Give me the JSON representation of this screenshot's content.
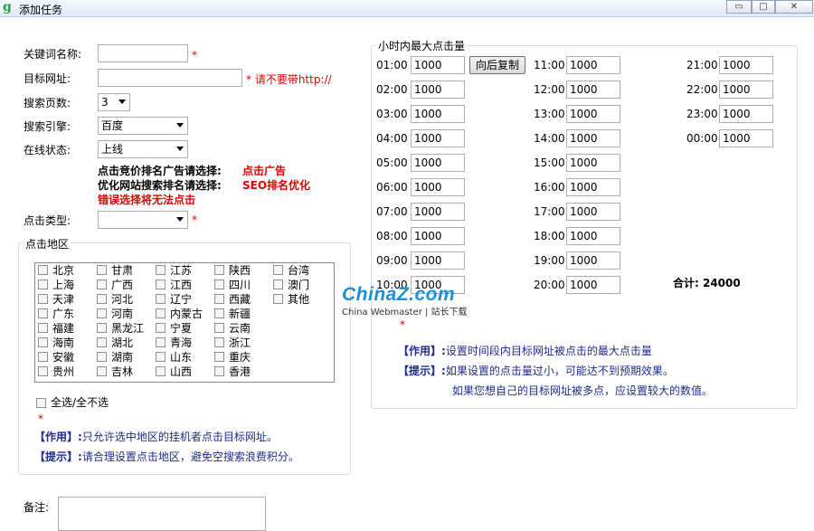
{
  "window": {
    "title": "添加任务",
    "min": "▭",
    "max": "□",
    "close": "✕"
  },
  "form": {
    "keyword_label": "关键词名称:",
    "url_label": "目标网址:",
    "url_hint": "* 请不要带http://",
    "pages_label": "搜索页数:",
    "pages_value": "3",
    "engine_label": "搜索引擎:",
    "engine_value": "百度",
    "status_label": "在线状态:",
    "status_value": "上线",
    "tip1_text": "点击竞价排名广告请选择:",
    "tip1_value": "点击广告",
    "tip2_text": "优化网站搜索排名请选择:",
    "tip2_value": "SEO排名优化",
    "tip3": "错误选择将无法点击",
    "click_type_label": "点击类型:",
    "star": "*",
    "note_label": "备注:"
  },
  "region": {
    "legend": "点击地区",
    "columns": [
      [
        "北京",
        "上海",
        "天津",
        "广东",
        "福建",
        "海南",
        "安徽",
        "贵州"
      ],
      [
        "甘肃",
        "广西",
        "河北",
        "河南",
        "黑龙江",
        "湖北",
        "湖南",
        "吉林"
      ],
      [
        "江苏",
        "江西",
        "辽宁",
        "内蒙古",
        "宁夏",
        "青海",
        "山东",
        "山西"
      ],
      [
        "陕西",
        "四川",
        "西藏",
        "新疆",
        "云南",
        "浙江",
        "重庆",
        "香港"
      ],
      [
        "台湾",
        "澳门",
        "其他"
      ]
    ],
    "select_all": "全选/全不选",
    "star": "*",
    "effect_label": "【作用】:",
    "effect_text": "只允许选中地区的挂机者点击目标网址。",
    "tip_label": "【提示】:",
    "tip_text": "请合理设置点击地区，避免空搜索浪费积分。"
  },
  "hours": {
    "legend": "小时内最大点击量",
    "copy_button": "向后复制",
    "rows": [
      {
        "h": "01:00",
        "v": "1000"
      },
      {
        "h": "02:00",
        "v": "1000"
      },
      {
        "h": "03:00",
        "v": "1000"
      },
      {
        "h": "04:00",
        "v": "1000"
      },
      {
        "h": "05:00",
        "v": "1000"
      },
      {
        "h": "06:00",
        "v": "1000"
      },
      {
        "h": "07:00",
        "v": "1000"
      },
      {
        "h": "08:00",
        "v": "1000"
      },
      {
        "h": "09:00",
        "v": "1000"
      },
      {
        "h": "10:00",
        "v": "1000"
      },
      {
        "h": "11:00",
        "v": "1000"
      },
      {
        "h": "12:00",
        "v": "1000"
      },
      {
        "h": "13:00",
        "v": "1000"
      },
      {
        "h": "14:00",
        "v": "1000"
      },
      {
        "h": "15:00",
        "v": "1000"
      },
      {
        "h": "16:00",
        "v": "1000"
      },
      {
        "h": "17:00",
        "v": "1000"
      },
      {
        "h": "18:00",
        "v": "1000"
      },
      {
        "h": "19:00",
        "v": "1000"
      },
      {
        "h": "20:00",
        "v": "1000"
      },
      {
        "h": "21:00",
        "v": "1000"
      },
      {
        "h": "22:00",
        "v": "1000"
      },
      {
        "h": "23:00",
        "v": "1000"
      },
      {
        "h": "00:00",
        "v": "1000"
      }
    ],
    "total": "合计: 24000",
    "star": "*",
    "effect_label": "【作用】:",
    "effect_text": "设置时间段内目标网址被点击的最大点击量",
    "tip_label": "【提示】:",
    "tip_text": "如果设置的点击量过小，可能达不到预期效果。",
    "tip_text2": "如果您想自己的目标网址被多点，应设置较大的数值。"
  },
  "watermark": {
    "brand": "ChinaZ.com",
    "sub": "China Webmaster | 站长下载"
  }
}
